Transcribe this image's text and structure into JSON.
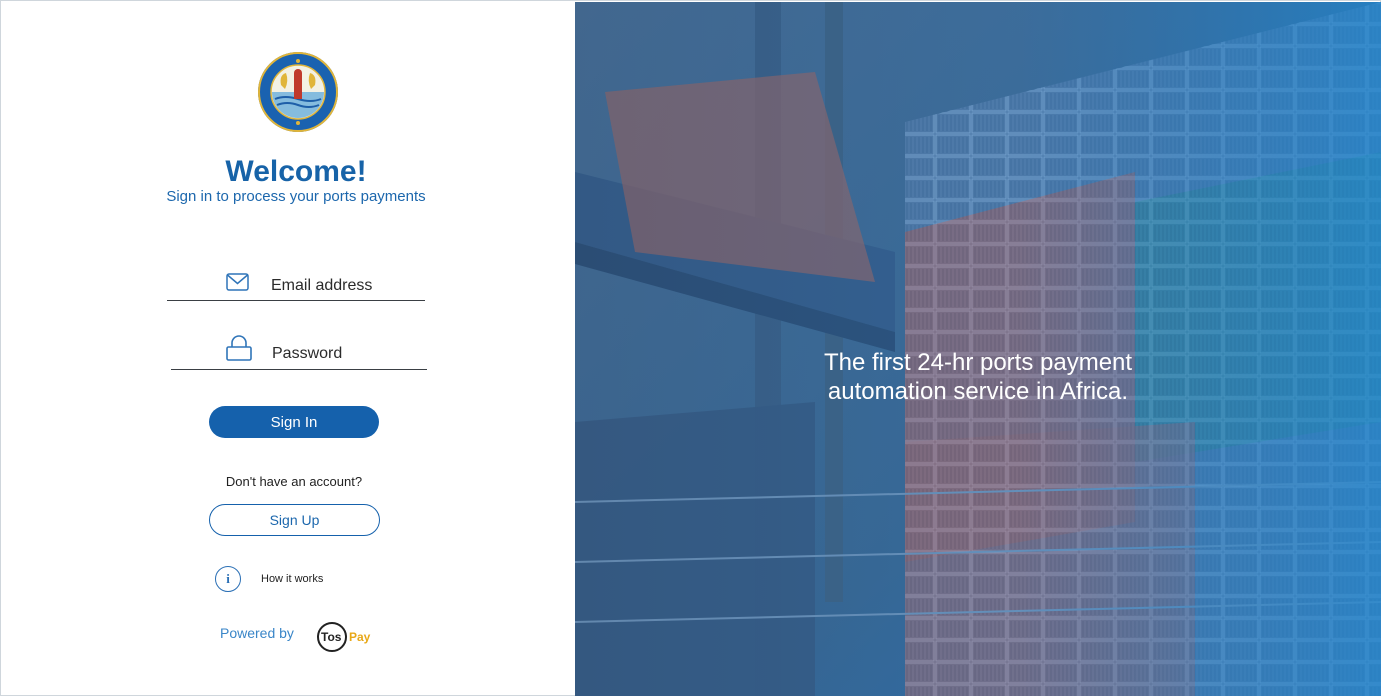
{
  "welcome": {
    "title": "Welcome!",
    "subtitle": "Sign in to process your ports payments"
  },
  "logo": {
    "name": "kenya-ports-authority-logo",
    "text": "KENYA PORTS AUTHORITY"
  },
  "form": {
    "email_placeholder": "Email address",
    "password_placeholder": "Password",
    "email_icon": "envelope-icon",
    "password_icon": "lock-icon",
    "signin_label": "Sign In"
  },
  "signup": {
    "prompt": "Don't have an account?",
    "button_label": "Sign Up"
  },
  "help": {
    "icon_label": "i",
    "label": "How it works"
  },
  "footer": {
    "powered_by": "Powered by",
    "brand_part1": "Tos",
    "brand_part2": "Pay"
  },
  "hero": {
    "tagline_line1": "The first 24-hr ports payment",
    "tagline_line2": "automation service in Africa."
  },
  "colors": {
    "primary": "#1561ac",
    "heading": "#1763a8",
    "hero_overlay": "#1e6fb5",
    "brand_pay": "#e8a818"
  }
}
